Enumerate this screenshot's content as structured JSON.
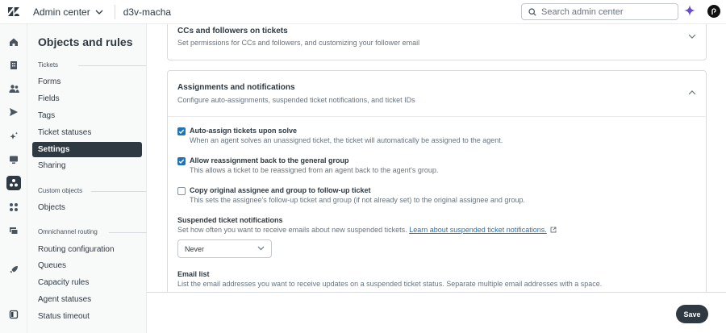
{
  "topbar": {
    "product": "Admin center",
    "account": "d3v-macha",
    "search_placeholder": "Search admin center"
  },
  "sidenav": {
    "title": "Objects and rules",
    "sections": [
      {
        "label": "Tickets",
        "items": [
          "Forms",
          "Fields",
          "Tags",
          "Ticket statuses",
          "Settings",
          "Sharing"
        ]
      },
      {
        "label": "Custom objects",
        "items": [
          "Objects"
        ]
      },
      {
        "label": "Omnichannel routing",
        "items": [
          "Routing configuration",
          "Queues",
          "Capacity rules",
          "Agent statuses",
          "Status timeout"
        ]
      }
    ],
    "active_item": "Settings"
  },
  "cards": {
    "ccs": {
      "title": "CCs and followers on tickets",
      "description": "Set permissions for CCs and followers, and customizing your follower email"
    },
    "assignments": {
      "title": "Assignments and notifications",
      "description": "Configure auto-assignments, suspended ticket notifications, and ticket IDs",
      "options": [
        {
          "label": "Auto-assign tickets upon solve",
          "description": "When an agent solves an unassigned ticket, the ticket will automatically be assigned to the agent.",
          "checked": true
        },
        {
          "label": "Allow reassignment back to the general group",
          "description": "This allows a ticket to be reassigned from an agent back to the agent's group.",
          "checked": true
        },
        {
          "label": "Copy original assignee and group to follow-up ticket",
          "description": "This sets the assignee's follow-up ticket and group (if not already set) to the original assignee and group.",
          "checked": false
        }
      ],
      "suspended": {
        "label": "Suspended ticket notifications",
        "description": "Set how often you want to receive emails about new suspended tickets.",
        "link": "Learn about suspended ticket notifications.",
        "value": "Never"
      },
      "email_list": {
        "label": "Email list",
        "description": "List the email addresses you want to receive updates on a suspended ticket status. Separate multiple email addresses with a space."
      }
    }
  },
  "footer": {
    "save_label": "Save"
  },
  "colors": {
    "accent": "#1f73b7",
    "dark": "#2f3941",
    "border": "#d8dcde"
  }
}
